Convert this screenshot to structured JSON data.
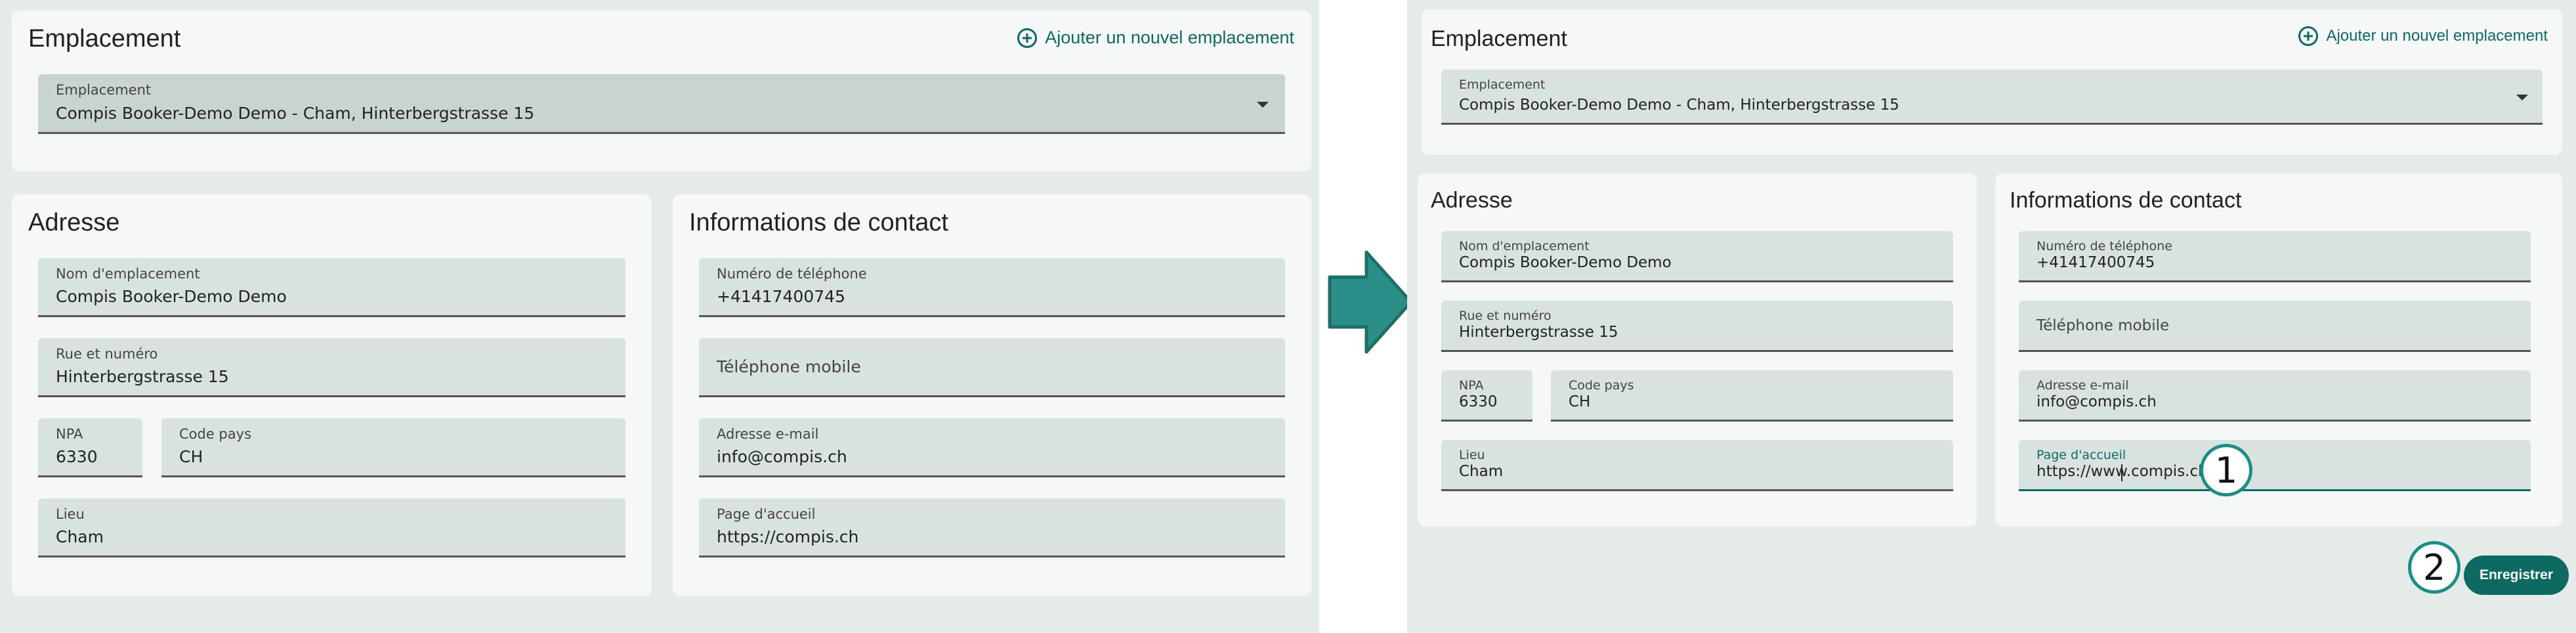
{
  "left_view": {
    "location_card": {
      "title": "Emplacement",
      "add_link": "Ajouter un nouvel emplacement",
      "select": {
        "label": "Emplacement",
        "value": "Compis Booker-Demo Demo - Cham, Hinterbergstrasse 15"
      }
    },
    "address_card": {
      "title": "Adresse",
      "fields": {
        "name": {
          "label": "Nom d'emplacement",
          "value": "Compis Booker-Demo Demo"
        },
        "street": {
          "label": "Rue et numéro",
          "value": "Hinterbergstrasse 15"
        },
        "npa": {
          "label": "NPA",
          "value": "6330"
        },
        "country": {
          "label": "Code pays",
          "value": "CH"
        },
        "city": {
          "label": "Lieu",
          "value": "Cham"
        }
      }
    },
    "contact_card": {
      "title": "Informations de contact",
      "fields": {
        "phone": {
          "label": "Numéro de téléphone",
          "value": "+41417400745"
        },
        "mobile": {
          "placeholder": "Téléphone mobile"
        },
        "email": {
          "label": "Adresse e-mail",
          "value": "info@compis.ch"
        },
        "homepage": {
          "label": "Page d'accueil",
          "value": "https://compis.ch"
        }
      }
    }
  },
  "right_view": {
    "location_card": {
      "title": "Emplacement",
      "add_link": "Ajouter un nouvel emplacement",
      "select": {
        "label": "Emplacement",
        "value": "Compis Booker-Demo Demo - Cham, Hinterbergstrasse 15"
      }
    },
    "address_card": {
      "title": "Adresse",
      "fields": {
        "name": {
          "label": "Nom d'emplacement",
          "value": "Compis Booker-Demo Demo"
        },
        "street": {
          "label": "Rue et numéro",
          "value": "Hinterbergstrasse 15"
        },
        "npa": {
          "label": "NPA",
          "value": "6330"
        },
        "country": {
          "label": "Code pays",
          "value": "CH"
        },
        "city": {
          "label": "Lieu",
          "value": "Cham"
        }
      }
    },
    "contact_card": {
      "title": "Informations de contact",
      "fields": {
        "phone": {
          "label": "Numéro de téléphone",
          "value": "+41417400745"
        },
        "mobile": {
          "placeholder": "Téléphone mobile"
        },
        "email": {
          "label": "Adresse e-mail",
          "value": "info@compis.ch"
        },
        "homepage": {
          "label": "Page d'accueil",
          "value": "https://www.compis.ch"
        }
      }
    },
    "save_button": "Enregistrer",
    "steps": {
      "one": "1",
      "two": "2"
    }
  },
  "colors": {
    "accent": "#0d6a63",
    "panel_bg": "#e5ebe8",
    "card_bg": "#f5f8f7",
    "field_bg": "#d8e3df",
    "arrow": "#2a8f87"
  },
  "icons": [
    "add-circle-icon",
    "dropdown-caret-icon",
    "right-arrow-icon"
  ]
}
